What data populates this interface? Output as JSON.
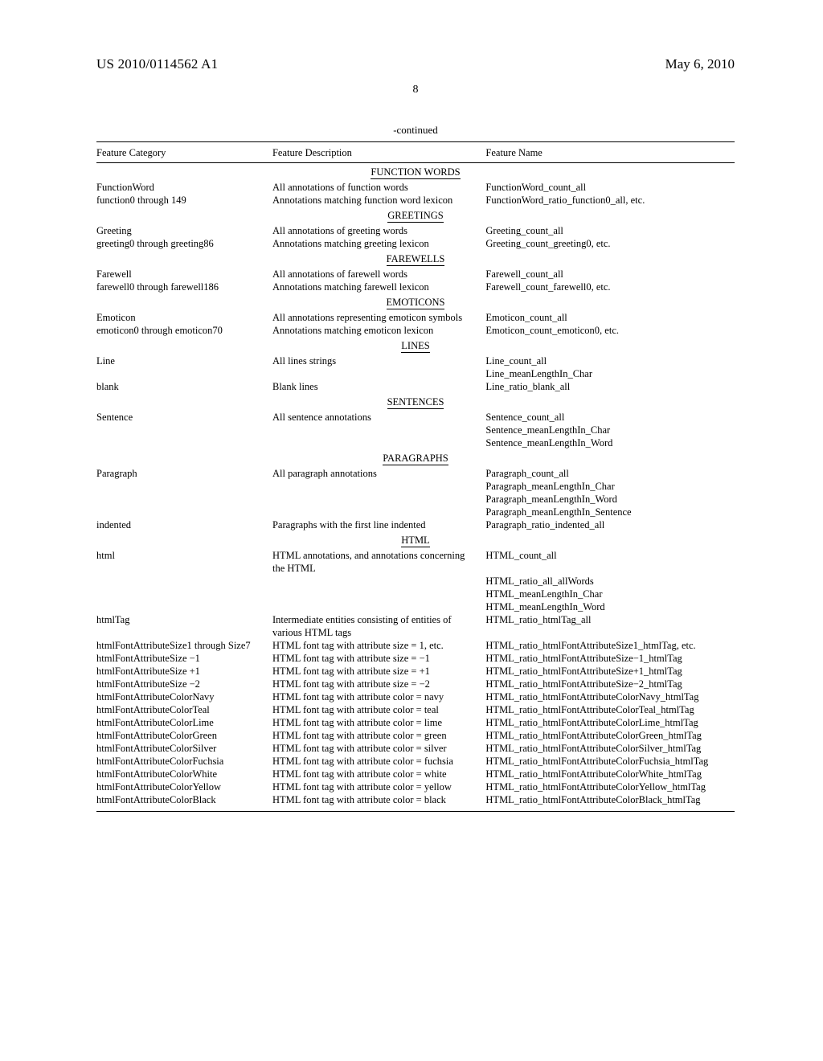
{
  "header": {
    "doc_id": "US 2010/0114562 A1",
    "date": "May 6, 2010",
    "page_number": "8",
    "continued": "-continued"
  },
  "columns": {
    "c1": "Feature Category",
    "c2": "Feature Description",
    "c3": "Feature Name"
  },
  "sections": [
    {
      "title": "FUNCTION WORDS",
      "rows": [
        {
          "c1": "FunctionWord",
          "c2": "All annotations of function words",
          "c3": "FunctionWord_count_all"
        },
        {
          "c1": "function0 through 149",
          "c2": "Annotations matching function word lexicon",
          "c3": "FunctionWord_ratio_function0_all, etc."
        }
      ]
    },
    {
      "title": "GREETINGS",
      "rows": [
        {
          "c1": "Greeting",
          "c2": "All annotations of greeting words",
          "c3": "Greeting_count_all"
        },
        {
          "c1": "greeting0 through greeting86",
          "c2": "Annotations matching greeting lexicon",
          "c3": "Greeting_count_greeting0, etc."
        }
      ]
    },
    {
      "title": "FAREWELLS",
      "rows": [
        {
          "c1": "Farewell",
          "c2": "All annotations of farewell words",
          "c3": "Farewell_count_all"
        },
        {
          "c1": "farewell0 through farewell186",
          "c2": "Annotations matching farewell lexicon",
          "c3": "Farewell_count_farewell0, etc."
        }
      ]
    },
    {
      "title": "EMOTICONS",
      "rows": [
        {
          "c1": "Emoticon",
          "c2": "All annotations representing emoticon symbols",
          "c3": "Emoticon_count_all"
        },
        {
          "c1": "emoticon0 through emoticon70",
          "c2": "Annotations matching emoticon lexicon",
          "c3": "Emoticon_count_emoticon0, etc."
        }
      ]
    },
    {
      "title": "LINES",
      "rows": [
        {
          "c1": "Line",
          "c2": "All lines strings",
          "c3": "Line_count_all"
        },
        {
          "c1": "",
          "c2": "",
          "c3": "Line_meanLengthIn_Char"
        },
        {
          "c1": "blank",
          "c2": "Blank lines",
          "c3": "Line_ratio_blank_all"
        }
      ]
    },
    {
      "title": "SENTENCES",
      "rows": [
        {
          "c1": "Sentence",
          "c2": "All sentence annotations",
          "c3": "Sentence_count_all"
        },
        {
          "c1": "",
          "c2": "",
          "c3": "Sentence_meanLengthIn_Char"
        },
        {
          "c1": "",
          "c2": "",
          "c3": "Sentence_meanLengthIn_Word"
        }
      ]
    },
    {
      "title": "PARAGRAPHS",
      "rows": [
        {
          "c1": "Paragraph",
          "c2": "All paragraph annotations",
          "c3": "Paragraph_count_all"
        },
        {
          "c1": "",
          "c2": "",
          "c3": "Paragraph_meanLengthIn_Char"
        },
        {
          "c1": "",
          "c2": "",
          "c3": "Paragraph_meanLengthIn_Word"
        },
        {
          "c1": "",
          "c2": "",
          "c3": "Paragraph_meanLengthIn_Sentence"
        },
        {
          "c1": "indented",
          "c2": "Paragraphs with the first line indented",
          "c3": "Paragraph_ratio_indented_all"
        }
      ]
    },
    {
      "title": "HTML",
      "rows": [
        {
          "c1": "html",
          "c2": "HTML annotations, and annotations concerning the HTML",
          "c3": "HTML_count_all"
        },
        {
          "c1": "",
          "c2": "",
          "c3": "HTML_ratio_all_allWords"
        },
        {
          "c1": "",
          "c2": "",
          "c3": "HTML_meanLengthIn_Char"
        },
        {
          "c1": "",
          "c2": "",
          "c3": "HTML_meanLengthIn_Word"
        },
        {
          "c1": "htmlTag",
          "c2": "Intermediate entities consisting of entities of various HTML tags",
          "c3": "HTML_ratio_htmlTag_all"
        },
        {
          "c1": "htmlFontAttributeSize1 through Size7",
          "c2": "HTML font tag with attribute size = 1, etc.",
          "c3": "HTML_ratio_htmlFontAttributeSize1_htmlTag, etc."
        },
        {
          "c1": "htmlFontAttributeSize −1",
          "c2": "HTML font tag with attribute size = −1",
          "c3": "HTML_ratio_htmlFontAttributeSize−1_htmlTag"
        },
        {
          "c1": "htmlFontAttributeSize +1",
          "c2": "HTML font tag with attribute size = +1",
          "c3": "HTML_ratio_htmlFontAttributeSize+1_htmlTag"
        },
        {
          "c1": "htmlFontAttributeSize −2",
          "c2": "HTML font tag with attribute size = −2",
          "c3": "HTML_ratio_htmlFontAttributeSize−2_htmlTag"
        },
        {
          "c1": "htmlFontAttributeColorNavy",
          "c2": "HTML font tag with attribute color = navy",
          "c3": "HTML_ratio_htmlFontAttributeColorNavy_htmlTag"
        },
        {
          "c1": "htmlFontAttributeColorTeal",
          "c2": "HTML font tag with attribute color = teal",
          "c3": "HTML_ratio_htmlFontAttributeColorTeal_htmlTag"
        },
        {
          "c1": "htmlFontAttributeColorLime",
          "c2": "HTML font tag with attribute color = lime",
          "c3": "HTML_ratio_htmlFontAttributeColorLime_htmlTag"
        },
        {
          "c1": "htmlFontAttributeColorGreen",
          "c2": "HTML font tag with attribute color = green",
          "c3": "HTML_ratio_htmlFontAttributeColorGreen_htmlTag"
        },
        {
          "c1": "htmlFontAttributeColorSilver",
          "c2": "HTML font tag with attribute color = silver",
          "c3": "HTML_ratio_htmlFontAttributeColorSilver_htmlTag"
        },
        {
          "c1": "htmlFontAttributeColorFuchsia",
          "c2": "HTML font tag with attribute color = fuchsia",
          "c3": "HTML_ratio_htmlFontAttributeColorFuchsia_htmlTag"
        },
        {
          "c1": "htmlFontAttributeColorWhite",
          "c2": "HTML font tag with attribute color = white",
          "c3": "HTML_ratio_htmlFontAttributeColorWhite_htmlTag"
        },
        {
          "c1": "htmlFontAttributeColorYellow",
          "c2": "HTML font tag with attribute color = yellow",
          "c3": "HTML_ratio_htmlFontAttributeColorYellow_htmlTag"
        },
        {
          "c1": "htmlFontAttributeColorBlack",
          "c2": "HTML font tag with attribute color = black",
          "c3": "HTML_ratio_htmlFontAttributeColorBlack_htmlTag"
        }
      ]
    }
  ]
}
